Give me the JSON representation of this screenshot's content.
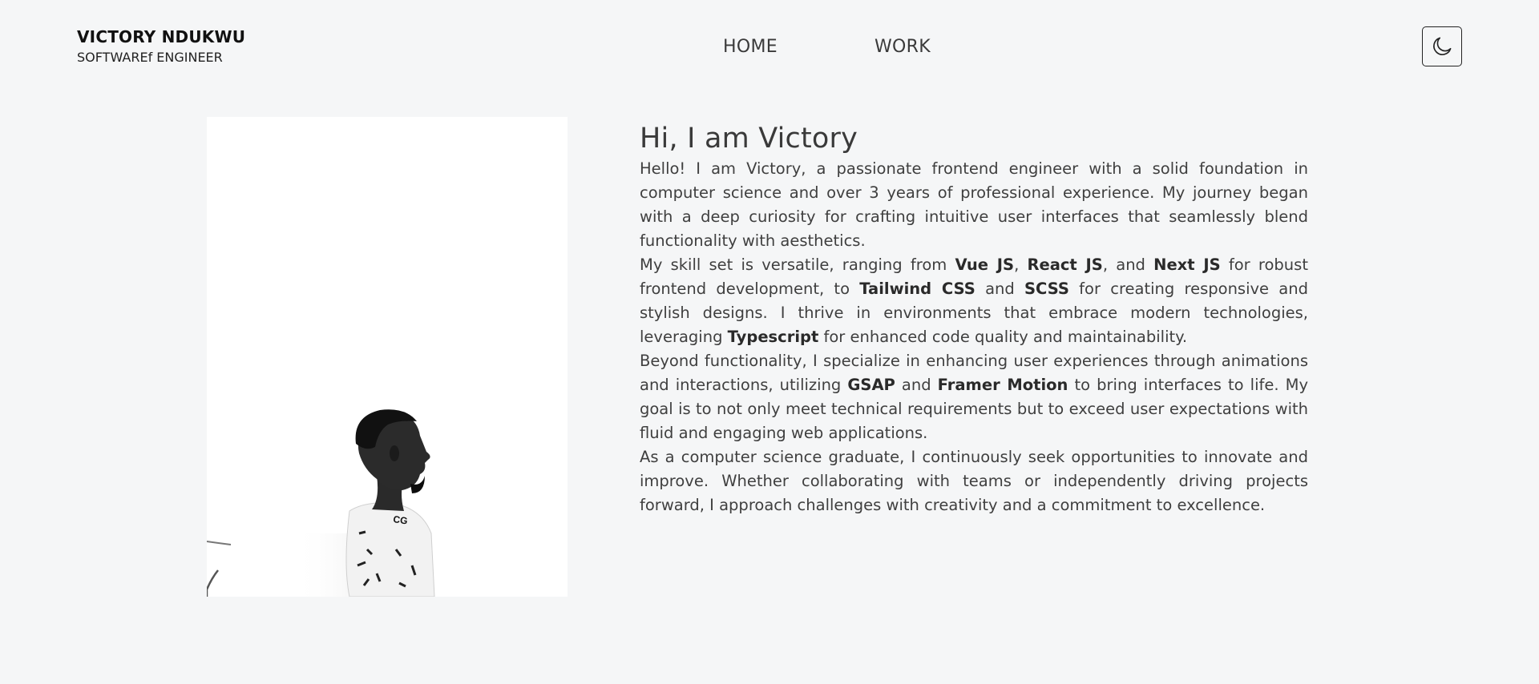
{
  "header": {
    "brand_name": "VICTORY NDUKWU",
    "brand_role": "SOFTWAREf ENGINEER",
    "nav": [
      {
        "label": "HOME"
      },
      {
        "label": "WORK"
      }
    ],
    "theme_toggle_icon": "moon-icon"
  },
  "main": {
    "portrait_icon": "portrait-photo",
    "title": "Hi, I am Victory",
    "paragraphs": {
      "p1": "Hello! I am Victory, a passionate frontend engineer with a solid foundation in computer science and over 3 years of professional experience. My journey began with a deep curiosity for crafting intuitive user interfaces that seamlessly blend functionality with aesthetics.",
      "p2": {
        "t1": "My skill set is versatile, ranging from ",
        "vue": "Vue JS",
        "t2": ", ",
        "react": "React JS",
        "t3": ", and ",
        "next": "Next JS",
        "t4": " for robust frontend development, to ",
        "tailwind": "Tailwind CSS",
        "t5": " and ",
        "scss": "SCSS",
        "t6": " for creating responsive and stylish designs. I thrive in environments that embrace modern technologies, leveraging ",
        "typescript": "Typescript",
        "t7": " for enhanced code quality and maintainability."
      },
      "p3": {
        "t1": "Beyond functionality, I specialize in enhancing user experiences through animations and interactions, utilizing ",
        "gsap": "GSAP",
        "t2": " and ",
        "framer": "Framer Motion",
        "t3": " to bring interfaces to life. My goal is to not only meet technical requirements but to exceed user expectations with fluid and engaging web applications."
      },
      "p4": "As a computer science graduate, I continuously seek opportunities to innovate and improve. Whether collaborating with teams or independently driving projects forward, I approach challenges with creativity and a commitment to excellence."
    }
  },
  "colors": {
    "background": "#f5f6f7",
    "text": "#3a3a3a",
    "brand": "#111111"
  }
}
